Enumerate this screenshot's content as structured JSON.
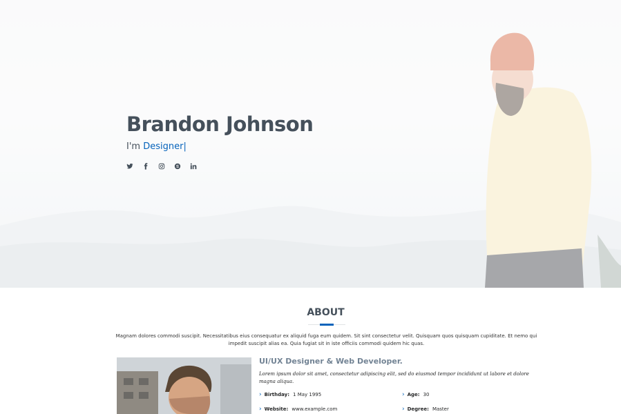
{
  "hero": {
    "name": "Brandon Johnson",
    "typed_prefix": "I'm",
    "typed_role": "Designer",
    "typed_cursor": "|",
    "socials": [
      {
        "icon": "twitter-icon"
      },
      {
        "icon": "facebook-icon"
      },
      {
        "icon": "instagram-icon"
      },
      {
        "icon": "skype-icon"
      },
      {
        "icon": "linkedin-icon"
      }
    ]
  },
  "about": {
    "title": "ABOUT",
    "intro": "Magnam dolores commodi suscipit. Necessitatibus eius consequatur ex aliquid fuga eum quidem. Sit sint consectetur velit. Quisquam quos quisquam cupiditate. Et nemo qui impedit suscipit alias ea. Quia fugiat sit in iste officiis commodi quidem hic quas.",
    "heading": "UI/UX Designer & Web Developer.",
    "lead": "Lorem ipsum dolor sit amet, consectetur adipiscing elit, sed do eiusmod tempor incididunt ut labore et dolore magna aliqua.",
    "info": {
      "birthday_label": "Birthday:",
      "birthday_value": "1 May 1995",
      "age_label": "Age:",
      "age_value": "30",
      "website_label": "Website:",
      "website_value": "www.example.com",
      "degree_label": "Degree:",
      "degree_value": "Master"
    }
  },
  "colors": {
    "accent": "#0563bb",
    "heading": "#45505b",
    "subheading": "#728394"
  }
}
